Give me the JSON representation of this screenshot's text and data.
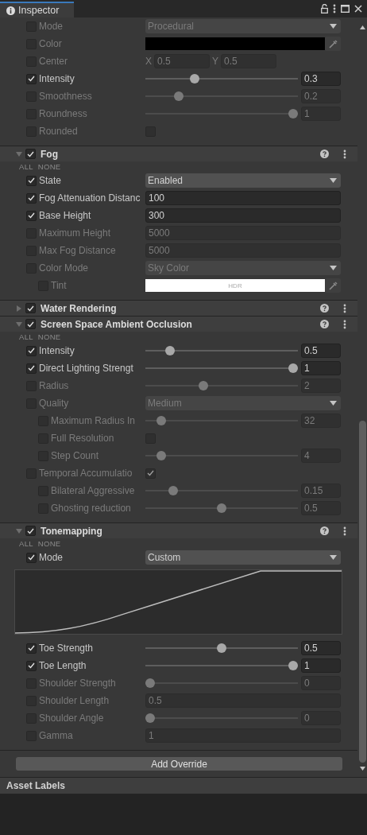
{
  "tab": {
    "title": "Inspector"
  },
  "sections": [
    {
      "rows": [
        {
          "kind": "dropdown",
          "label": "Mode",
          "checked": false,
          "value": "Procedural"
        },
        {
          "kind": "color",
          "label": "Color",
          "checked": false,
          "color": "#000000"
        },
        {
          "kind": "vector2",
          "label": "Center",
          "checked": false,
          "components": [
            {
              "axis": "X",
              "value": "0.5"
            },
            {
              "axis": "Y",
              "value": "0.5"
            }
          ]
        },
        {
          "kind": "slider",
          "label": "Intensity",
          "checked": true,
          "level": 0.31,
          "value": "0.3"
        },
        {
          "kind": "slider",
          "label": "Smoothness",
          "checked": false,
          "level": 0.2,
          "value": "0.2"
        },
        {
          "kind": "slider",
          "label": "Roundness",
          "checked": false,
          "level": 1,
          "value": "1"
        },
        {
          "kind": "toggle",
          "label": "Rounded",
          "checked": false,
          "on": false
        }
      ]
    },
    {
      "title": "Fog",
      "enabled": true,
      "expanded": true,
      "select_all": "ALL",
      "select_none": "NONE",
      "rows": [
        {
          "kind": "dropdown",
          "label": "State",
          "checked": true,
          "value": "Enabled"
        },
        {
          "kind": "field",
          "label": "Fog Attenuation Distanc",
          "checked": true,
          "value": "100"
        },
        {
          "kind": "field",
          "label": "Base Height",
          "checked": true,
          "value": "300"
        },
        {
          "kind": "field",
          "label": "Maximum Height",
          "checked": false,
          "value": "5000"
        },
        {
          "kind": "field",
          "label": "Max Fog Distance",
          "checked": false,
          "value": "5000"
        },
        {
          "kind": "dropdown",
          "label": "Color Mode",
          "checked": false,
          "value": "Sky Color",
          "children": [
            {
              "kind": "color",
              "label": "Tint",
              "checked": false,
              "color": "#ffffff",
              "badge": "HDR"
            }
          ]
        }
      ]
    },
    {
      "title": "Water Rendering",
      "enabled": true,
      "expanded": false
    },
    {
      "title": "Screen Space Ambient Occlusion",
      "enabled": true,
      "expanded": true,
      "select_all": "ALL",
      "select_none": "NONE",
      "rows": [
        {
          "kind": "slider",
          "label": "Intensity",
          "checked": true,
          "level": 0.14,
          "value": "0.5"
        },
        {
          "kind": "slider",
          "label": "Direct Lighting Strengt",
          "checked": true,
          "level": 1,
          "value": "1"
        },
        {
          "kind": "slider",
          "label": "Radius",
          "checked": false,
          "level": 0.37,
          "value": "2"
        },
        {
          "kind": "dropdown",
          "label": "Quality",
          "checked": false,
          "value": "Medium",
          "children": [
            {
              "kind": "slider",
              "label": "Maximum Radius In",
              "checked": false,
              "level": 0.08,
              "value": "32"
            },
            {
              "kind": "toggle",
              "label": "Full Resolution",
              "checked": false,
              "on": false
            },
            {
              "kind": "slider",
              "label": "Step Count",
              "checked": false,
              "level": 0.08,
              "value": "4"
            }
          ]
        },
        {
          "kind": "toggle",
          "label": "Temporal Accumulatio",
          "checked": false,
          "on": true,
          "children": [
            {
              "kind": "slider",
              "label": "Bilateral Aggressive",
              "checked": false,
              "level": 0.16,
              "value": "0.15"
            },
            {
              "kind": "slider",
              "label": "Ghosting reduction",
              "checked": false,
              "level": 0.5,
              "value": "0.5"
            }
          ]
        }
      ]
    },
    {
      "title": "Tonemapping",
      "enabled": true,
      "expanded": true,
      "select_all": "ALL",
      "select_none": "NONE",
      "rows": [
        {
          "kind": "dropdown",
          "label": "Mode",
          "checked": true,
          "value": "Custom"
        },
        {
          "kind": "curve"
        },
        {
          "kind": "slider",
          "label": "Toe Strength",
          "checked": true,
          "level": 0.5,
          "value": "0.5"
        },
        {
          "kind": "slider",
          "label": "Toe Length",
          "checked": true,
          "level": 1,
          "value": "1"
        },
        {
          "kind": "slider",
          "label": "Shoulder Strength",
          "checked": false,
          "level": 0,
          "value": "0"
        },
        {
          "kind": "field",
          "label": "Shoulder Length",
          "checked": false,
          "value": "0.5"
        },
        {
          "kind": "slider",
          "label": "Shoulder Angle",
          "checked": false,
          "level": 0,
          "value": "0"
        },
        {
          "kind": "field",
          "label": "Gamma",
          "checked": false,
          "value": "1"
        }
      ]
    }
  ],
  "add_button": "Add Override",
  "footer": {
    "title": "Asset Labels"
  }
}
